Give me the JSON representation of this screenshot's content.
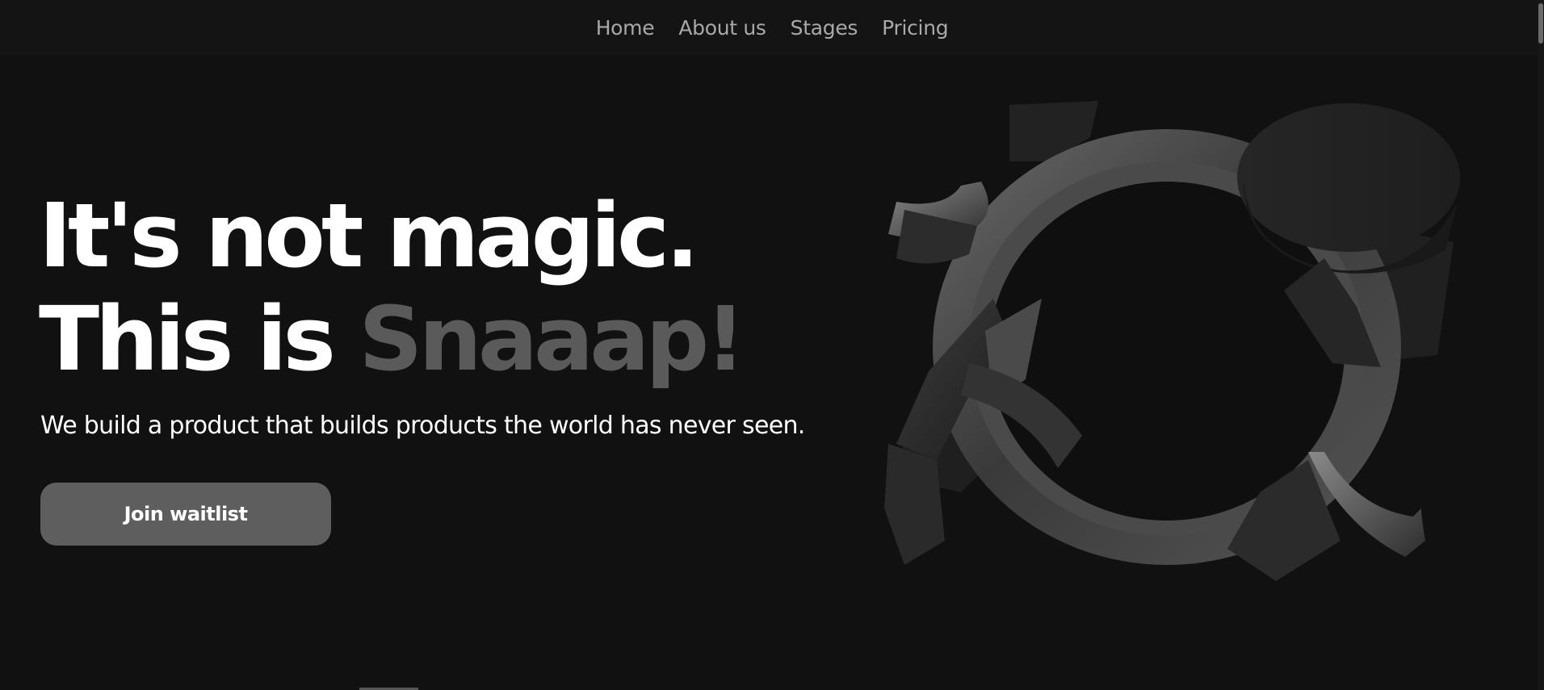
{
  "nav": {
    "items": [
      {
        "label": "Home"
      },
      {
        "label": "About us"
      },
      {
        "label": "Stages"
      },
      {
        "label": "Pricing"
      }
    ]
  },
  "hero": {
    "line1": "It's not magic.",
    "line2_prefix": "This is ",
    "line2_accent": "Snaaap!",
    "subtitle": "We build a product that builds products the world has never seen.",
    "cta_label": "Join waitlist"
  },
  "colors": {
    "background": "#111111",
    "accent_text": "#5a5a5a",
    "button": "#5e5e5e",
    "nav_text": "#a9a9a9"
  }
}
